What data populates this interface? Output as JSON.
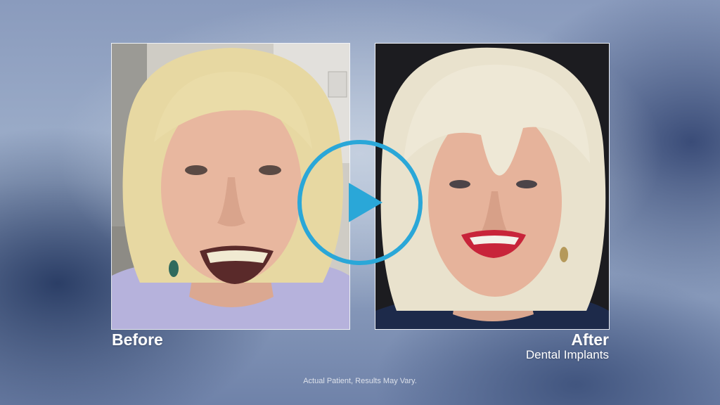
{
  "video": {
    "before_label": "Before",
    "after_label": "After",
    "after_sublabel": "Dental Implants",
    "disclaimer": "Actual Patient, Results May Vary."
  },
  "play_button": {
    "icon": "play-icon",
    "color": "#2aa7d8"
  },
  "colors": {
    "before_background": "#c9c6bf",
    "after_background": "#1c1c20",
    "hair": "#e6d9a8",
    "skin": "#e8b9a2",
    "shirt_before": "#b6b2dc",
    "lips_after": "#c8243a"
  }
}
